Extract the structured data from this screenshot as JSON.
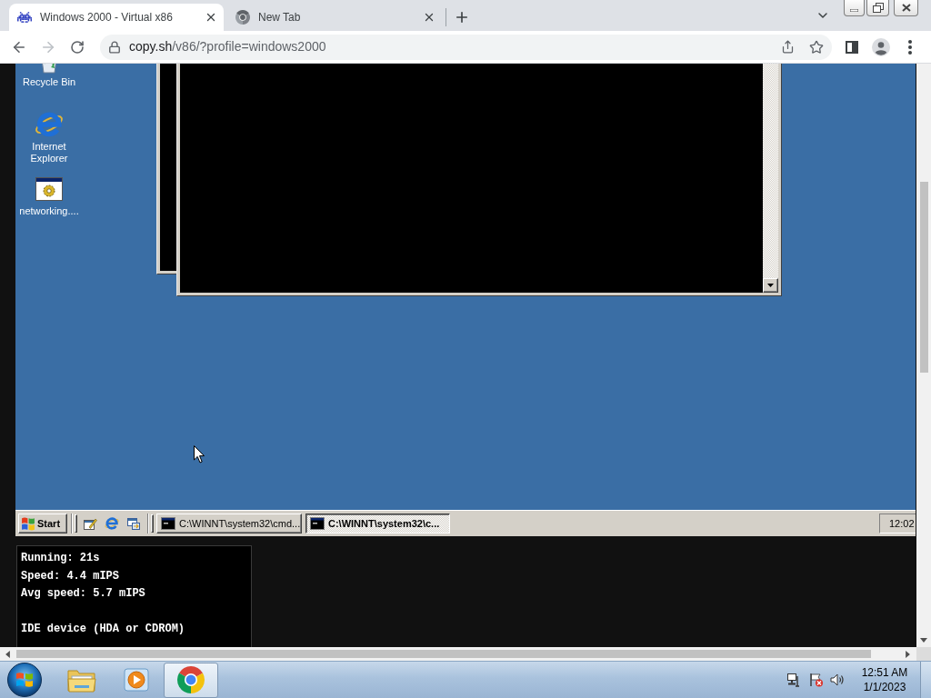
{
  "browser": {
    "tabs": [
      {
        "kind": "site",
        "title": "Windows 2000 - Virtual x86",
        "selected": true
      },
      {
        "kind": "new_tab",
        "title": "New Tab",
        "selected": false
      }
    ],
    "navigation": {
      "back_disabled": false,
      "forward_disabled": true
    },
    "address": {
      "host": "copy.sh",
      "path": "/v86/?profile=windows2000"
    }
  },
  "desktop": {
    "icons": [
      {
        "kind": "recycle_bin",
        "label": "Recycle Bin"
      },
      {
        "kind": "browser",
        "label": "Internet Explorer"
      },
      {
        "kind": "program",
        "label": "networking...."
      }
    ]
  },
  "win_taskbar": {
    "start": "Start",
    "tasks": [
      {
        "label": "C:\\WINNT\\system32\\cmd...",
        "selected": false
      },
      {
        "label": "C:\\WINNT\\system32\\c...",
        "selected": true
      }
    ],
    "clock": "12:02"
  },
  "stats": {
    "groups": [
      [
        "Running: 21s",
        "Speed: 4.4 mIPS",
        "Avg speed: 5.7 mIPS"
      ],
      [
        "IDE device (HDA or CDROM)"
      ]
    ]
  },
  "os_taskbar": {
    "pinned": [
      {
        "kind": "folder",
        "selected": false
      },
      {
        "kind": "media",
        "selected": false
      },
      {
        "kind": "browser",
        "selected": true
      }
    ],
    "clock": {
      "time": "12:51 AM",
      "date": "1/1/2023"
    }
  }
}
